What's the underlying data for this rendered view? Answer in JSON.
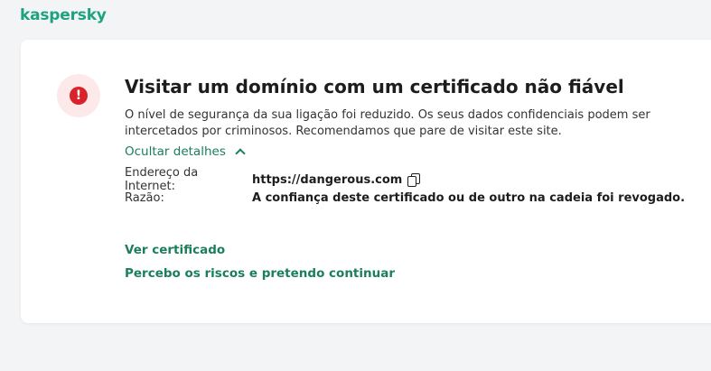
{
  "brand": {
    "logo_text": "kaspersky",
    "accent_color": "#1fa281"
  },
  "alert": {
    "icon": "exclamation-circle-icon",
    "symbol": "!",
    "icon_color": "#d8232a",
    "title": "Visitar um domínio com um certificado não fiável",
    "description": "O nível de segurança da sua ligação foi reduzido. Os seus dados confidenciais podem ser intercetados por criminosos. Recomendamos que pare de visitar este site."
  },
  "details": {
    "toggle_label": "Ocultar detalhes",
    "address_label": "Endereço da Internet:",
    "address_value": "https://dangerous.com",
    "reason_label": "Razão:",
    "reason_value": "A confiança deste certificado ou de outro na cadeia foi revogado."
  },
  "actions": {
    "view_certificate": "Ver certificado",
    "proceed": "Percebo os riscos e pretendo continuar"
  }
}
